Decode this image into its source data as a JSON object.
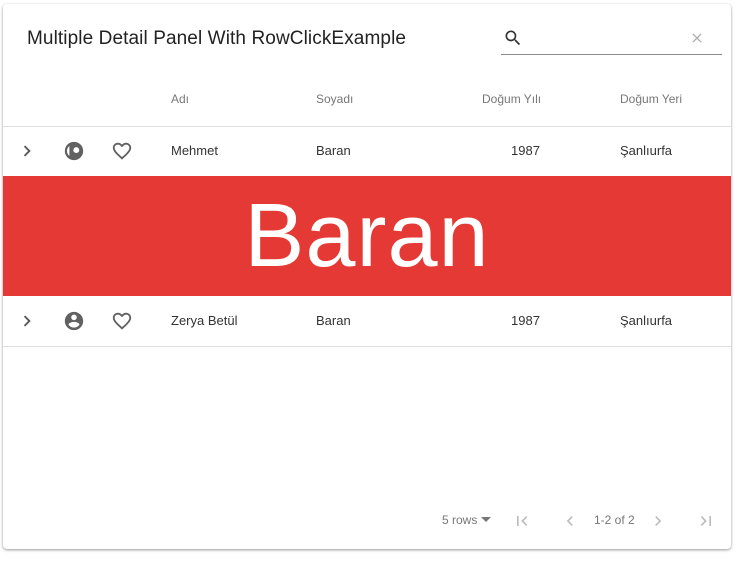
{
  "title": "Multiple Detail Panel With RowClickExample",
  "search": {
    "placeholder": "",
    "value": ""
  },
  "columns": [
    "Adı",
    "Soyadı",
    "Doğum Yılı",
    "Doğum Yeri"
  ],
  "rows": [
    {
      "first_name": "Mehmet",
      "last_name": "Baran",
      "birth_year": "1987",
      "birth_place": "Şanlıurfa",
      "person_icon": "account-circle-half-icon"
    },
    {
      "first_name": "Zerya Betül",
      "last_name": "Baran",
      "birth_year": "1987",
      "birth_place": "Şanlıurfa",
      "person_icon": "account-circle-icon"
    }
  ],
  "detail_panel": {
    "text": "Baran",
    "background": "#e53935",
    "color": "#ffffff"
  },
  "pagination": {
    "rows_per_page": "5 rows",
    "info": "1-2 of 2"
  },
  "icons": {
    "search": "search-icon",
    "clear": "close-icon",
    "expand": "chevron-right-icon",
    "favorite": "heart-outline-icon",
    "first_page": "first-page-icon",
    "prev_page": "chevron-left-icon",
    "next_page": "chevron-right-icon",
    "last_page": "last-page-icon"
  }
}
